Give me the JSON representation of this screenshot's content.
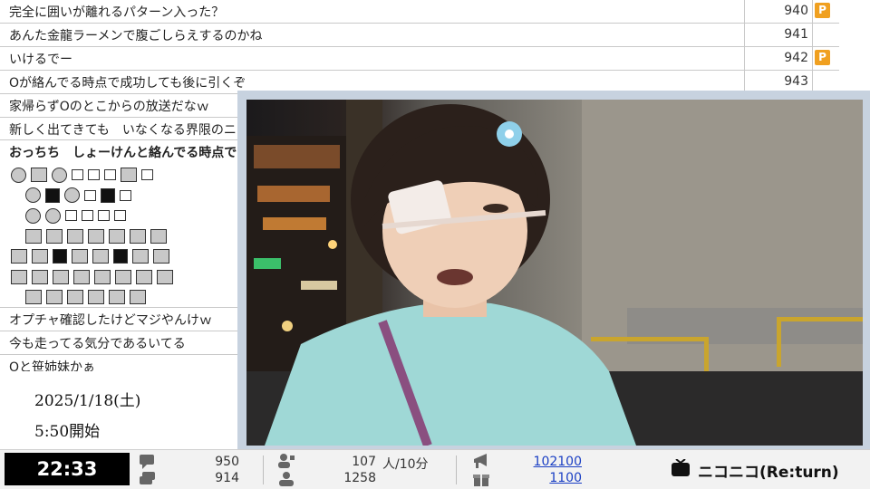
{
  "comments": [
    {
      "text": "完全に囲いが離れるパターン入った？",
      "number": "940",
      "premium": true
    },
    {
      "text": "あんた金龍ラーメンで腹ごしらえするのかね",
      "number": "941",
      "premium": false
    },
    {
      "text": "いけるでー",
      "number": "942",
      "premium": true
    },
    {
      "text": "Oが絡んでる時点で成功しても後に引くぞ",
      "number": "943",
      "premium": false
    },
    {
      "text": "家帰らずOのとこからの放送だなｗ",
      "number": "",
      "premium": false
    },
    {
      "text": "新しく出てきても　いなくなる界限のニコ",
      "number": "",
      "premium": false
    },
    {
      "text": "おっちち　しょーけんと絡んでる時点で同",
      "number": "",
      "premium": false
    }
  ],
  "comments_after": [
    {
      "text": "オプチャ確認したけどマジやんけｗ"
    },
    {
      "text": "今も走ってる気分であるいてる"
    },
    {
      "text": "Oと笹姉妹かぁ"
    }
  ],
  "premium_badge": "P",
  "info": {
    "date": "2025/1/18(土)",
    "start": "5:50開始"
  },
  "status": {
    "elapsed": "22:33",
    "comments_total": "950",
    "comments_sub": "914",
    "viewers_active": "107",
    "viewers_rate": "人/10分",
    "viewers_total": "1258",
    "ad_points": "102100",
    "gift_points": "1100",
    "logo": "ニコニコ(Re:turn)"
  },
  "colors": {
    "premium": "#f0a020",
    "link": "#1a3fc4",
    "clock_bg": "#000000"
  }
}
